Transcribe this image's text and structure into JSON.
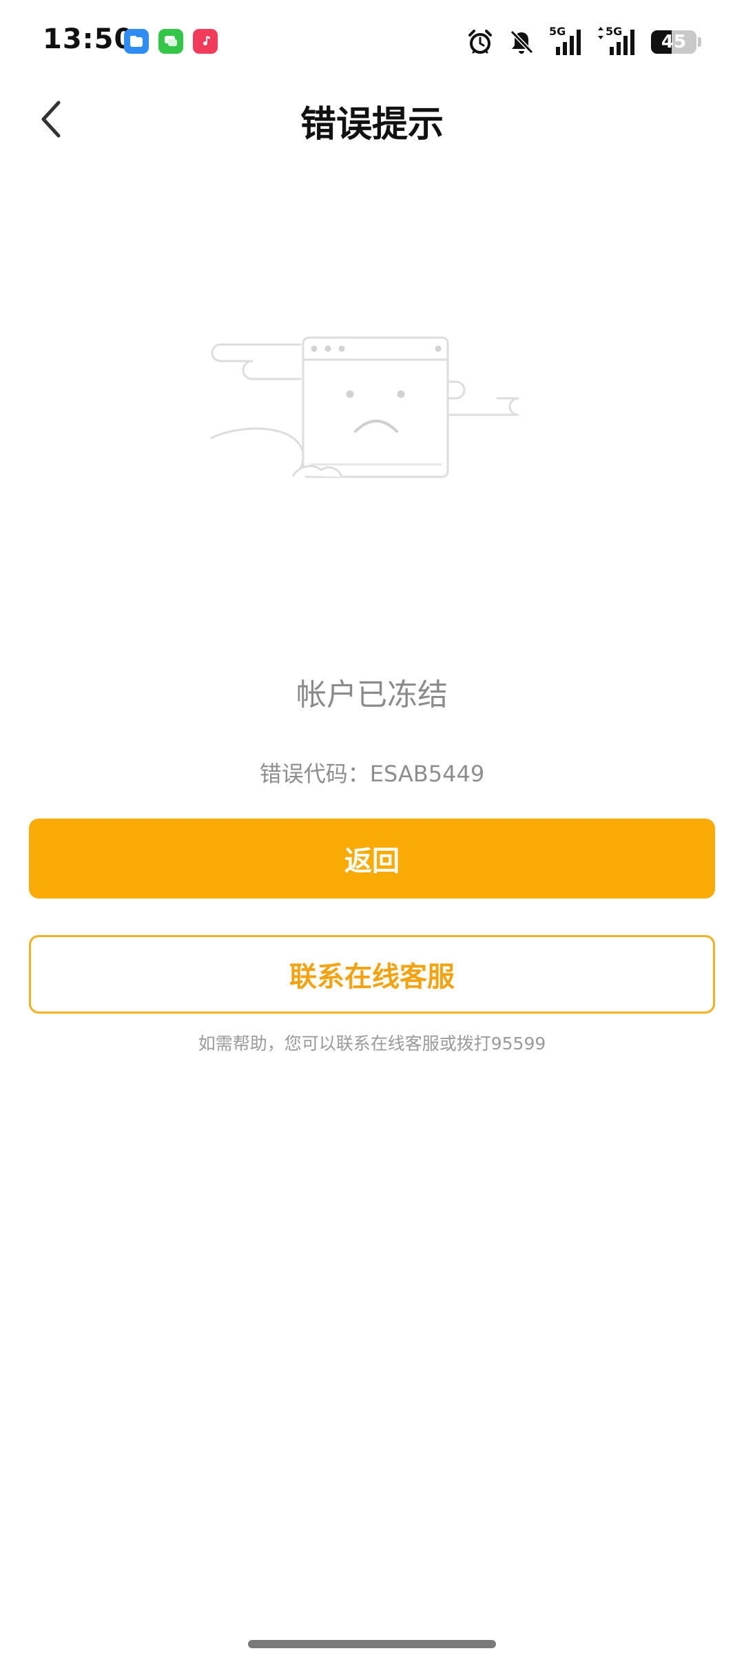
{
  "status_bar": {
    "time": "13:50",
    "apps": [
      "files-icon",
      "messages-icon",
      "music-icon"
    ],
    "indicators": [
      "alarm-icon",
      "bell-muted-icon",
      "signal-5g-icon",
      "signal-5g-icon"
    ],
    "network_label_1": "5G",
    "network_label_2": "5G",
    "battery_level": "45",
    "battery_percent": 45
  },
  "nav": {
    "back_icon": "chevron-left-icon",
    "title": "错误提示"
  },
  "main": {
    "illustration_icon": "sad-browser-icon",
    "message": "帐户已冻结",
    "error_code": "错误代码：ESAB5449",
    "return_label": "返回",
    "contact_label": "联系在线客服",
    "help_text": "如需帮助，您可以联系在线客服或拨打95599"
  },
  "colors": {
    "primary": "#f9aa05",
    "outline": "#f3b021",
    "muted_text": "#8b8b8b"
  }
}
